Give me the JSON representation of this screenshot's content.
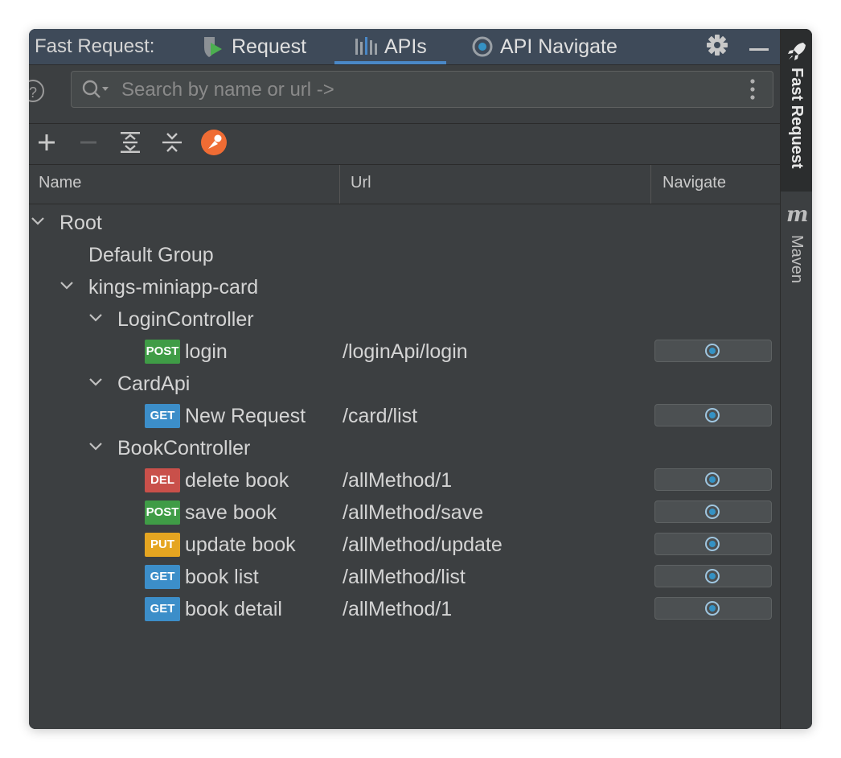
{
  "header": {
    "title": "Fast Request:",
    "tabs": [
      {
        "label": "Request",
        "icon": "request-shield-icon"
      },
      {
        "label": "APIs",
        "icon": "apis-bars-icon"
      },
      {
        "label": "API Navigate",
        "icon": "navigate-target-icon"
      }
    ],
    "active_tab": "APIs"
  },
  "search": {
    "placeholder": "Search by name or url ->"
  },
  "columns": {
    "name": "Name",
    "url": "Url",
    "navigate": "Navigate"
  },
  "tree": {
    "root": "Root",
    "default_group": "Default Group",
    "module": "kings-miniapp-card",
    "controllers": [
      {
        "name": "LoginController",
        "apis": [
          {
            "method": "POST",
            "name": "login",
            "url": "/loginApi/login"
          }
        ]
      },
      {
        "name": "CardApi",
        "apis": [
          {
            "method": "GET",
            "name": "New Request",
            "url": "/card/list"
          }
        ]
      },
      {
        "name": "BookController",
        "apis": [
          {
            "method": "DEL",
            "name": "delete book",
            "url": "/allMethod/1"
          },
          {
            "method": "POST",
            "name": "save book",
            "url": "/allMethod/save"
          },
          {
            "method": "PUT",
            "name": "update book",
            "url": "/allMethod/update"
          },
          {
            "method": "GET",
            "name": "book list",
            "url": "/allMethod/list"
          },
          {
            "method": "GET",
            "name": "book detail",
            "url": "/allMethod/1"
          }
        ]
      }
    ]
  },
  "method_colors": {
    "POST": "#3f9c46",
    "GET": "#3c8ec9",
    "DEL": "#c9504a",
    "PUT": "#e5a521"
  },
  "accent_color": "#4a88c7",
  "sidebar": {
    "fast_request": "Fast Request",
    "maven": "Maven",
    "maven_icon": "m"
  }
}
